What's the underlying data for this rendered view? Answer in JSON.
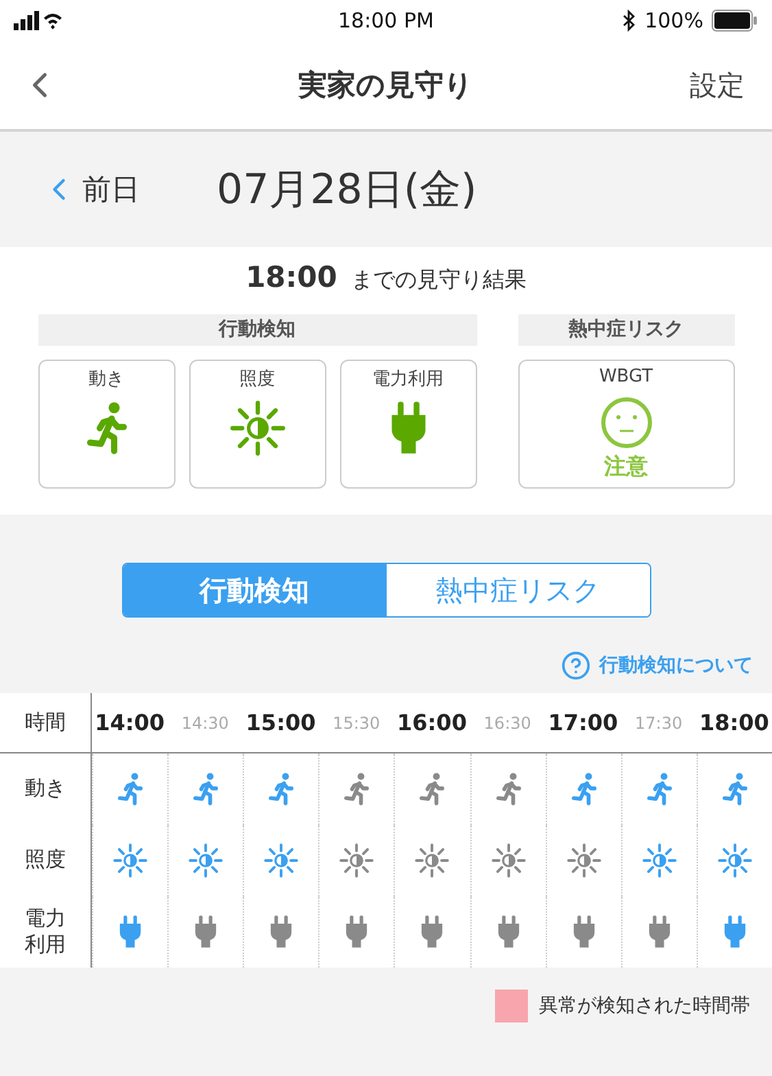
{
  "status_bar": {
    "time": "18:00 PM",
    "battery": "100%"
  },
  "nav": {
    "title": "実家の見守り",
    "action": "設定"
  },
  "date_bar": {
    "prev": "前日",
    "date": "07月28日(金)"
  },
  "summary": {
    "time": "18:00",
    "caption": "までの見守り結果"
  },
  "groups": [
    {
      "title": "行動検知",
      "cards": [
        {
          "label": "動き",
          "kind": "motion"
        },
        {
          "label": "照度",
          "kind": "light"
        },
        {
          "label": "電力利用",
          "kind": "power"
        }
      ]
    },
    {
      "title": "熱中症リスク",
      "cards": [
        {
          "label": "WBGT",
          "kind": "wbgt",
          "status": "注意"
        }
      ]
    }
  ],
  "tabs": [
    {
      "label": "行動検知",
      "selected": true
    },
    {
      "label": "熱中症リスク",
      "selected": false
    }
  ],
  "help_link": "行動検知について",
  "table": {
    "header": "時間",
    "rows": [
      {
        "label": "動き",
        "kind": "motion"
      },
      {
        "label": "照度",
        "kind": "light"
      },
      {
        "label": "電力利用",
        "kind": "power"
      }
    ],
    "slots": [
      {
        "time": "14:00",
        "major": true,
        "motion": true,
        "light": true,
        "power": true
      },
      {
        "time": "14:30",
        "major": false,
        "motion": true,
        "light": true,
        "power": false
      },
      {
        "time": "15:00",
        "major": true,
        "motion": true,
        "light": true,
        "power": false
      },
      {
        "time": "15:30",
        "major": false,
        "motion": false,
        "light": false,
        "power": false
      },
      {
        "time": "16:00",
        "major": true,
        "motion": false,
        "light": false,
        "power": false
      },
      {
        "time": "16:30",
        "major": false,
        "motion": false,
        "light": false,
        "power": false
      },
      {
        "time": "17:00",
        "major": true,
        "motion": true,
        "light": false,
        "power": false
      },
      {
        "time": "17:30",
        "major": false,
        "motion": true,
        "light": true,
        "power": false
      },
      {
        "time": "18:00",
        "major": true,
        "motion": true,
        "light": true,
        "power": true
      }
    ]
  },
  "legend": {
    "label": "異常が検知された時間帯",
    "color": "#f8a5ae"
  }
}
